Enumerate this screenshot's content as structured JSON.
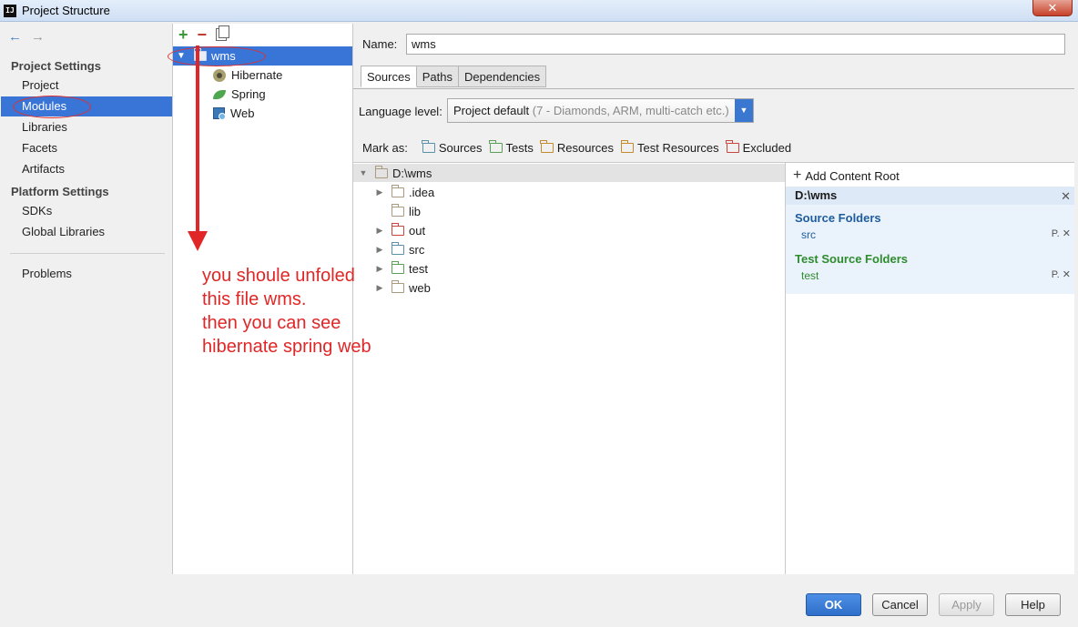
{
  "window": {
    "title": "Project Structure",
    "icon_text": "IJ",
    "close_glyph": "✕"
  },
  "nav": {
    "back_icon": "←",
    "forward_icon": "→",
    "project_settings_header": "Project Settings",
    "platform_settings_header": "Platform Settings",
    "items": {
      "project": "Project",
      "modules": "Modules",
      "libraries": "Libraries",
      "facets": "Facets",
      "artifacts": "Artifacts",
      "sdks": "SDKs",
      "global_libraries": "Global Libraries",
      "problems": "Problems"
    }
  },
  "module_tree": {
    "toolbar": {
      "add": "+",
      "remove": "−"
    },
    "root": "wms",
    "children": [
      "Hibernate",
      "Spring",
      "Web"
    ]
  },
  "module_details": {
    "name_label": "Name:",
    "name_value": "wms",
    "tabs": [
      "Sources",
      "Paths",
      "Dependencies"
    ],
    "language_label": "Language level:",
    "language_value": "Project default",
    "language_hint": "(7 - Diamonds, ARM, multi-catch etc.)",
    "mark_as_label": "Mark as:",
    "mark_as": [
      "Sources",
      "Tests",
      "Resources",
      "Test Resources",
      "Excluded"
    ]
  },
  "content_tree": {
    "root": "D:\\wms",
    "items": [
      ".idea",
      "lib",
      "out",
      "src",
      "test",
      "web"
    ]
  },
  "content_root_panel": {
    "add_label": "Add Content Root",
    "root_path": "D:\\wms",
    "source_header": "Source Folders",
    "source_entry": "src",
    "test_header": "Test Source Folders",
    "test_entry": "test",
    "entry_tools": "P. ✕"
  },
  "buttons": {
    "ok": "OK",
    "cancel": "Cancel",
    "apply": "Apply",
    "help": "Help"
  },
  "annotation": {
    "lines": [
      "you shoule unfoled",
      "this file wms.",
      "then you can see",
      "hibernate spring web"
    ],
    "color": "#e02626"
  }
}
